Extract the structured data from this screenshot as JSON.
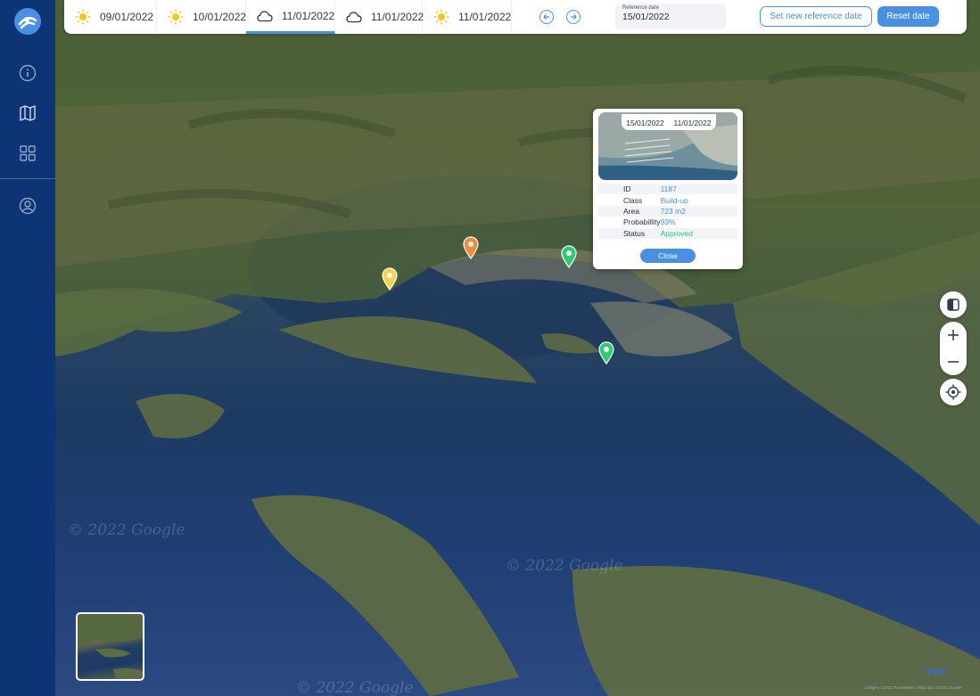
{
  "sidebar": {
    "items": [
      {
        "name": "info",
        "icon": "info-icon"
      },
      {
        "name": "map",
        "icon": "map-icon"
      },
      {
        "name": "dashboard",
        "icon": "grid-icon"
      },
      {
        "name": "profile",
        "icon": "user-icon"
      }
    ],
    "logo_icon": "app-logo-icon"
  },
  "topbar": {
    "dates": [
      {
        "label": "09/01/2022",
        "weather": "sun-icon",
        "active": false
      },
      {
        "label": "10/01/2022",
        "weather": "sun-icon",
        "active": false
      },
      {
        "label": "11/01/2022",
        "weather": "cloud-icon",
        "active": true
      },
      {
        "label": "11/01/2022",
        "weather": "cloud-icon",
        "active": false
      },
      {
        "label": "11/01/2022",
        "weather": "sun-icon",
        "active": false
      }
    ],
    "reference_label": "Reference date",
    "reference_value": "15/01/2022",
    "set_reference_button": "Set new reference date",
    "reset_button": "Reset date"
  },
  "popup": {
    "dates": [
      "15/01/2022",
      "11/01/2022"
    ],
    "rows": [
      {
        "key": "ID",
        "value": "1187"
      },
      {
        "key": "Class",
        "value": "Build-up"
      },
      {
        "key": "Area",
        "value": "723 m2"
      },
      {
        "key": "Probabillity",
        "value": "93%"
      },
      {
        "key": "Status",
        "value": "Approved"
      }
    ],
    "close_label": "Close"
  },
  "map": {
    "watermark": "© 2022 Google",
    "attribution": "Imagery ©2022 TerraMetrics, Map data ©2022 Google",
    "brand": "esa",
    "markers": [
      {
        "name": "yellow",
        "color": "#f2d349"
      },
      {
        "name": "orange",
        "color": "#f08a3c"
      },
      {
        "name": "green",
        "color": "#2ecc71"
      },
      {
        "name": "green",
        "color": "#2ecc71"
      }
    ]
  },
  "colors": {
    "sidebar": "#0d3474",
    "accent": "#4a90e2",
    "approved": "#2ecc71",
    "sun": "#f5c518"
  }
}
